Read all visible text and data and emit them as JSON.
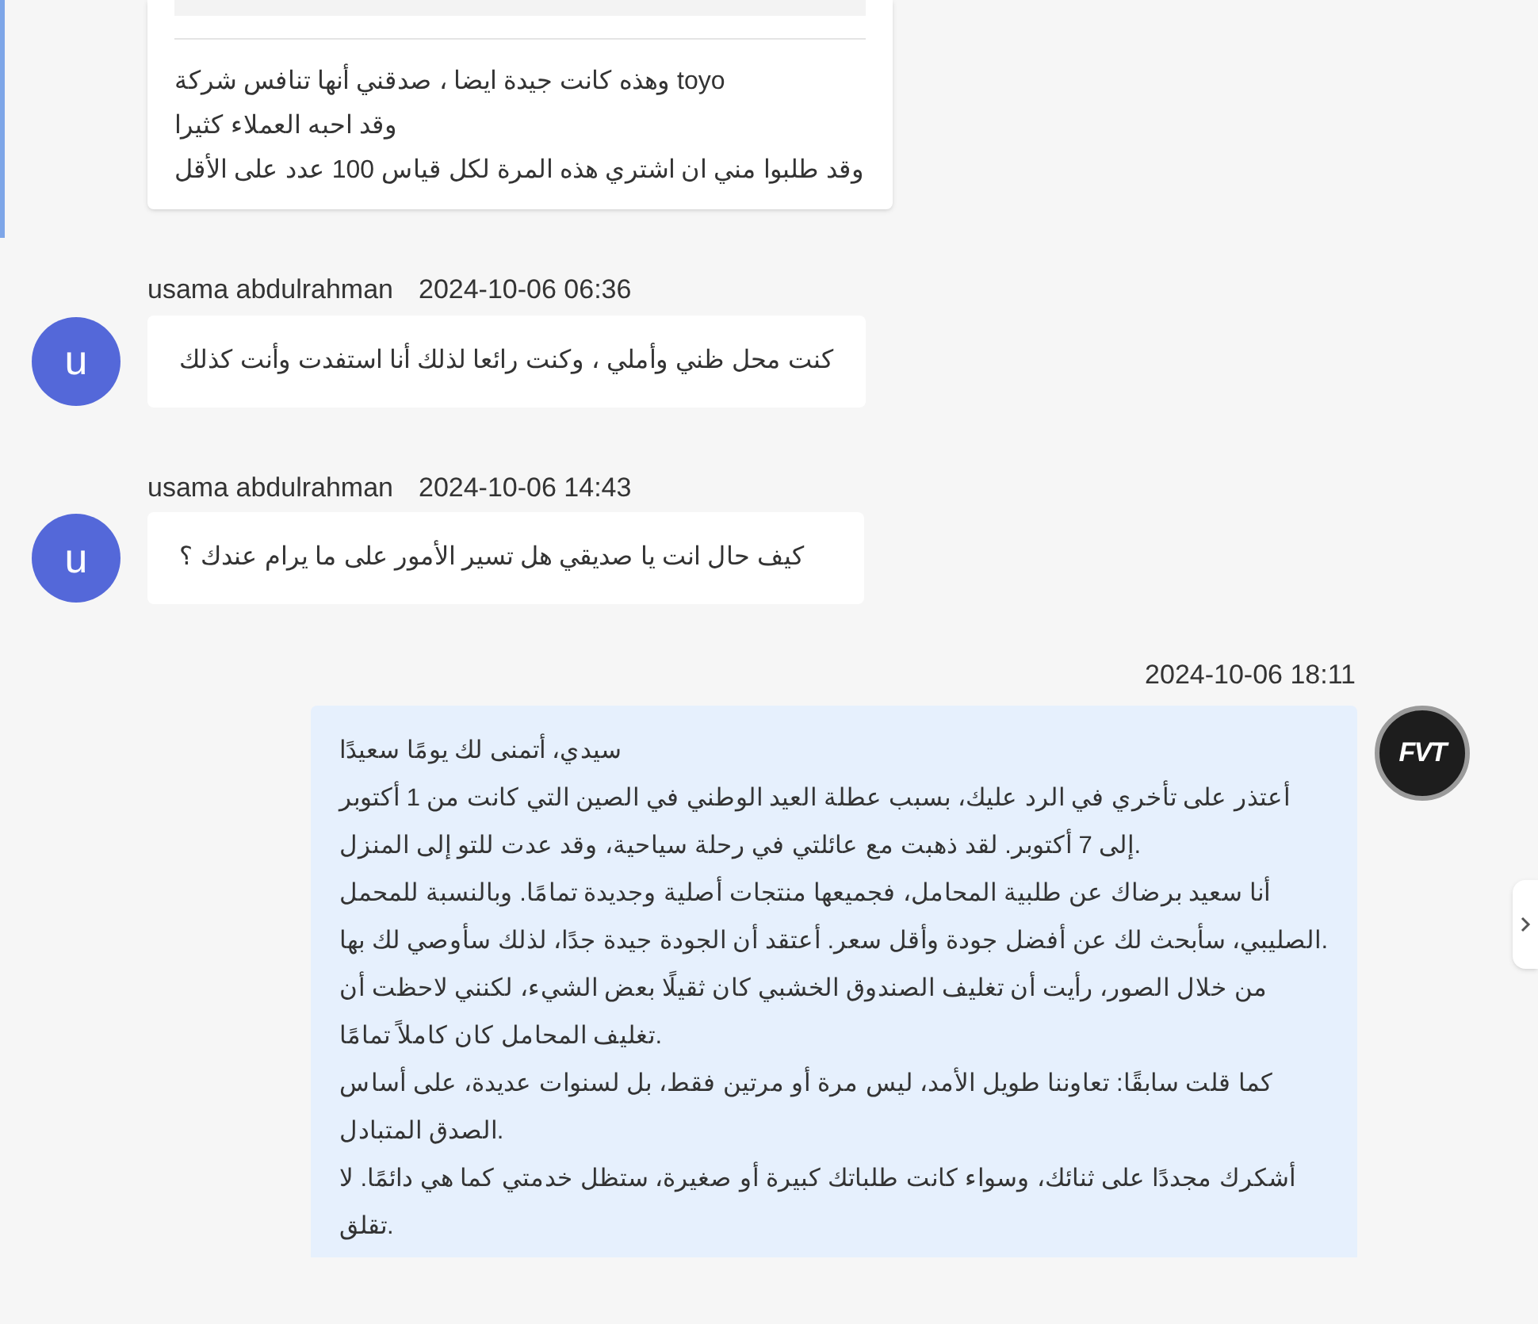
{
  "top_message": {
    "lines": [
      "وهذه كانت جيدة ايضا ، صدقني أنها تنافس شركة toyo",
      "وقد احبه العملاء كثيرا",
      "وقد طلبوا مني ان اشتري هذه المرة لكل قياس 100 عدد على الأقل"
    ]
  },
  "messages": [
    {
      "kind": "incoming",
      "sender": "usama abdulrahman",
      "time": "2024-10-06 06:36",
      "avatar_letter": "u",
      "paragraphs": [
        "كنت محل ظني وأملي ، وكنت رائعا لذلك أنا استفدت وأنت كذلك"
      ]
    },
    {
      "kind": "incoming",
      "sender": "usama abdulrahman",
      "time": "2024-10-06 14:43",
      "avatar_letter": "u",
      "paragraphs": [
        "كيف حال انت يا صديقي هل تسير الأمور على ما يرام عندك ؟"
      ]
    },
    {
      "kind": "outgoing",
      "time": "2024-10-06 18:11",
      "avatar_letter": "FVT",
      "paragraphs": [
        "سيدي، أتمنى لك يومًا سعيدًا",
        "أعتذر على تأخري في الرد عليك، بسبب عطلة العيد الوطني في الصين التي كانت من 1 أكتوبر إلى 7 أكتوبر. لقد ذهبت مع عائلتي في رحلة سياحية، وقد عدت للتو إلى المنزل.",
        "أنا سعيد برضاك عن طلبية المحامل، فجميعها منتجات أصلية وجديدة تمامًا. وبالنسبة للمحمل الصليبي، سأبحث لك عن أفضل جودة وأقل سعر. أعتقد أن الجودة جيدة جدًا، لذلك سأوصي لك بها.",
        "من خلال الصور، رأيت أن تغليف الصندوق الخشبي كان ثقيلًا بعض الشيء، لكنني لاحظت أن تغليف المحامل كان كاملاً تمامًا.",
        "كما قلت سابقًا: تعاوننا طويل الأمد، ليس مرة أو مرتين فقط، بل لسنوات عديدة، على أساس الصدق المتبادل.",
        "أشكرك مجددًا على ثنائك، وسواء كانت طلباتك كبيرة أو صغيرة، ستظل خدمتي كما هي دائمًا. لا تقلق."
      ]
    }
  ]
}
